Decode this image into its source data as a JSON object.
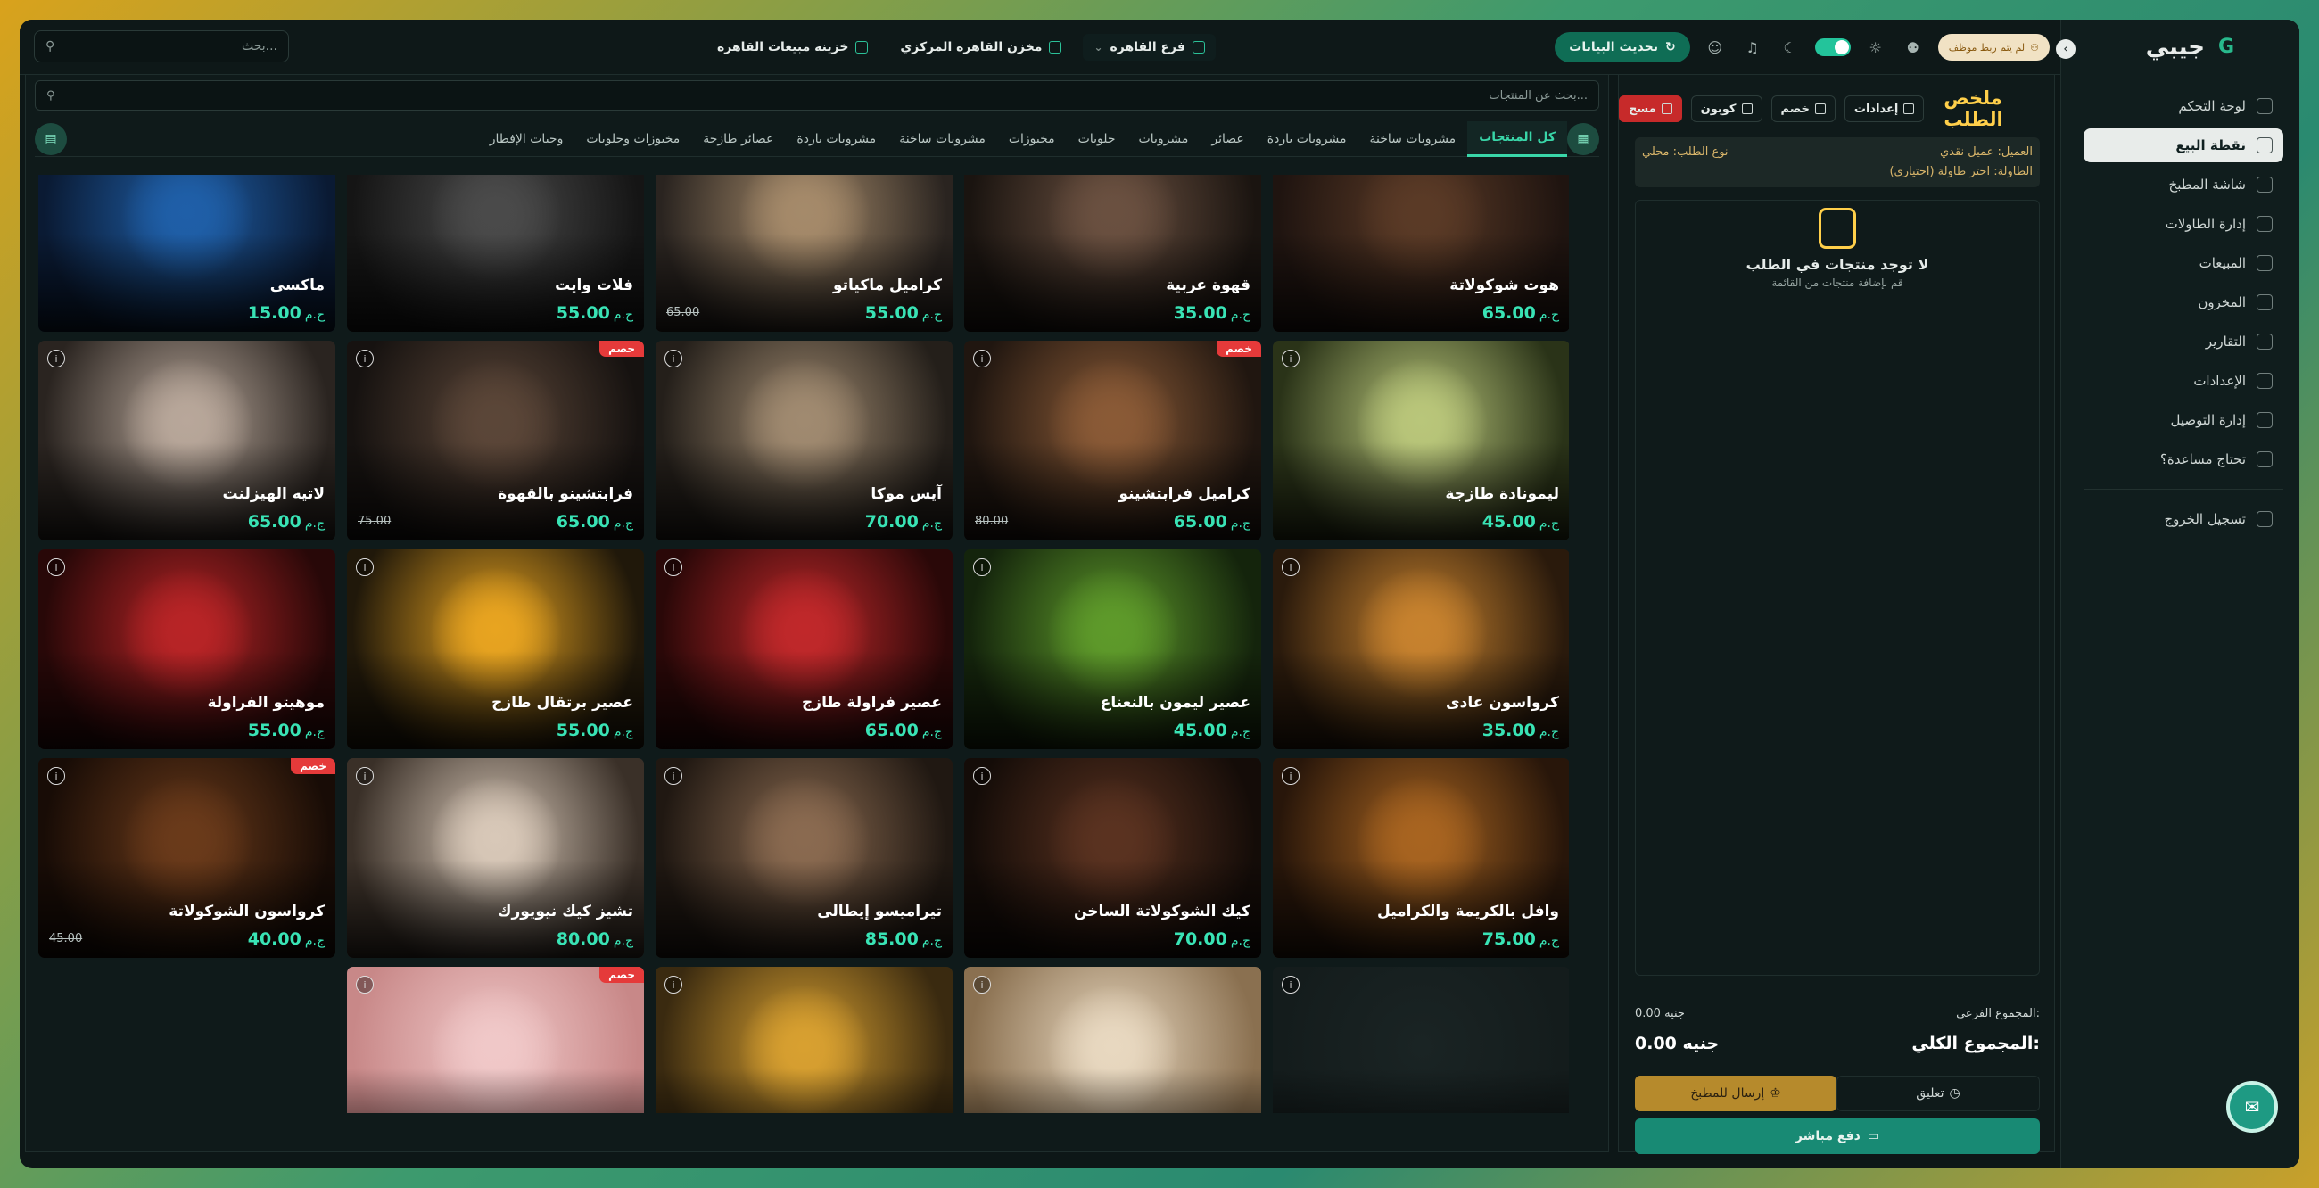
{
  "app": {
    "name": "جيبي",
    "logo_letter": "G"
  },
  "topbar": {
    "search_placeholder": "بحث...",
    "branch": "فرع القاهرة",
    "warehouse": "مخزن القاهرة المركزي",
    "treasury": "خزينة مبيعات القاهرة",
    "refresh_label": "تحديث البيانات",
    "staff_label": "لم يتم ربط موظف"
  },
  "sidebar": {
    "items": [
      {
        "label": "لوحة التحكم",
        "icon": "gauge-icon",
        "active": false
      },
      {
        "label": "نقطة البيع",
        "icon": "store-icon",
        "active": true
      },
      {
        "label": "شاشة المطبخ",
        "icon": "chef-hat-icon",
        "active": false
      },
      {
        "label": "إدارة الطاولات",
        "icon": "table-icon",
        "active": false
      },
      {
        "label": "المبيعات",
        "icon": "coin-icon",
        "active": false
      },
      {
        "label": "المخزون",
        "icon": "box-icon",
        "active": false
      },
      {
        "label": "التقارير",
        "icon": "report-icon",
        "active": false
      },
      {
        "label": "الإعدادات",
        "icon": "gear-icon",
        "active": false
      },
      {
        "label": "إدارة التوصيل",
        "icon": "bike-icon",
        "active": false
      },
      {
        "label": "تحتاج مساعدة؟",
        "icon": "help-icon",
        "active": false
      }
    ],
    "logout": "تسجيل الخروج"
  },
  "order": {
    "title": "ملخص الطلب",
    "settings": "إعدادات",
    "discount": "خصم",
    "coupon": "كوبون",
    "clear": "مسح",
    "customer_label": "العميل:",
    "customer_value": "عميل نقدي",
    "order_type_label": "نوع الطلب:",
    "order_type_value": "محلي",
    "table_label": "الطاولة:",
    "table_value": "اختر طاولة (اختياري)",
    "empty_title": "لا توجد منتجات في الطلب",
    "empty_sub": "قم بإضافة منتجات من القائمة",
    "subtotal_label": "المجموع الفرعي:",
    "subtotal_value": "0.00 جنيه",
    "total_label": "المجموع الكلي:",
    "total_value": "0.00 جنيه",
    "hold": "تعليق",
    "send_kitchen": "إرسال للمطبخ",
    "pay_direct": "دفع مباشر"
  },
  "products": {
    "search_placeholder": "بحث عن المنتجات...",
    "currency": "ج.م",
    "discount_badge": "خصم",
    "categories": [
      "كل المنتجات",
      "مشروبات ساخنة",
      "مشروبات باردة",
      "عصائر",
      "مشروبات",
      "حلويات",
      "مخبوزات",
      "مشروبات ساخنة",
      "مشروبات باردة",
      "عصائر طازجة",
      "مخبوزات وحلويات",
      "وجبات الإفطار"
    ],
    "rows": [
      [
        {
          "name": "هوت شوكولاتة",
          "price": "65.00",
          "old": "",
          "badge": false,
          "c1": "#5a3a26",
          "c2": "#1f1410"
        },
        {
          "name": "قهوة عربية",
          "price": "35.00",
          "old": "",
          "badge": false,
          "c1": "#6a5040",
          "c2": "#1a1410"
        },
        {
          "name": "كراميل ماكياتو",
          "price": "55.00",
          "old": "65.00",
          "badge": false,
          "c1": "#a58a6a",
          "c2": "#2a2420"
        },
        {
          "name": "فلات وايت",
          "price": "55.00",
          "old": "",
          "badge": false,
          "c1": "#4a4a4a",
          "c2": "#151515"
        },
        {
          "name": "ماكسى",
          "price": "15.00",
          "old": "",
          "badge": false,
          "c1": "#1f5fa8",
          "c2": "#0a1a33"
        }
      ],
      [
        {
          "name": "ليمونادة طازجة",
          "price": "45.00",
          "old": "",
          "badge": false,
          "c1": "#b9c67a",
          "c2": "#2a3318"
        },
        {
          "name": "كراميل فرابتشينو",
          "price": "65.00",
          "old": "80.00",
          "badge": true,
          "c1": "#8a5a36",
          "c2": "#201610"
        },
        {
          "name": "آيس موكا",
          "price": "70.00",
          "old": "",
          "badge": false,
          "c1": "#a08a70",
          "c2": "#241f1a"
        },
        {
          "name": "فرابتشينو بالقهوة",
          "price": "65.00",
          "old": "75.00",
          "badge": true,
          "c1": "#5b4638",
          "c2": "#161210"
        },
        {
          "name": "لاتيه الهيزلنت",
          "price": "65.00",
          "old": "",
          "badge": false,
          "c1": "#b8a79a",
          "c2": "#2a2420"
        }
      ],
      [
        {
          "name": "كرواسون عادى",
          "price": "35.00",
          "old": "",
          "badge": false,
          "c1": "#c7822e",
          "c2": "#2a1a0c"
        },
        {
          "name": "عصير ليمون بالنعناع",
          "price": "45.00",
          "old": "",
          "badge": false,
          "c1": "#5e9a2a",
          "c2": "#14240c"
        },
        {
          "name": "عصير فراولة طازج",
          "price": "65.00",
          "old": "",
          "badge": false,
          "c1": "#c0282a",
          "c2": "#2a0808"
        },
        {
          "name": "عصير برتقال طازج",
          "price": "55.00",
          "old": "",
          "badge": false,
          "c1": "#e8a420",
          "c2": "#20180a"
        },
        {
          "name": "موهيتو الفراولة",
          "price": "55.00",
          "old": "",
          "badge": false,
          "c1": "#b82426",
          "c2": "#280808"
        }
      ],
      [
        {
          "name": "وافل بالكريمة والكراميل",
          "price": "75.00",
          "old": "",
          "badge": false,
          "c1": "#a86420",
          "c2": "#28160a"
        },
        {
          "name": "كيك الشوكولاتة الساخن",
          "price": "70.00",
          "old": "",
          "badge": false,
          "c1": "#5a3220",
          "c2": "#140c08"
        },
        {
          "name": "تيراميسو إيطالى",
          "price": "85.00",
          "old": "",
          "badge": false,
          "c1": "#8a6a50",
          "c2": "#201812"
        },
        {
          "name": "تشيز كيك نيويورك",
          "price": "80.00",
          "old": "",
          "badge": false,
          "c1": "#d8c8b8",
          "c2": "#3a3028"
        },
        {
          "name": "كرواسون الشوكولاتة",
          "price": "40.00",
          "old": "45.00",
          "badge": true,
          "c1": "#6a3a1a",
          "c2": "#180c06"
        }
      ],
      [
        {
          "name": "",
          "price": "",
          "old": "",
          "badge": false,
          "c1": "#1a2424",
          "c2": "#141c1c",
          "empty": true
        },
        {
          "name": "",
          "price": "",
          "old": "",
          "badge": false,
          "c1": "#e8d8c0",
          "c2": "#8a7050"
        },
        {
          "name": "",
          "price": "",
          "old": "",
          "badge": false,
          "c1": "#d8a030",
          "c2": "#3a2a10"
        },
        {
          "name": "",
          "price": "",
          "old": "",
          "badge": true,
          "c1": "#f0c8c8",
          "c2": "#c88888"
        }
      ]
    ]
  },
  "colors": {
    "accent": "#39d6a8",
    "brand": "#0f6d55",
    "title": "#ffcf4a",
    "danger": "#c72a2a"
  }
}
